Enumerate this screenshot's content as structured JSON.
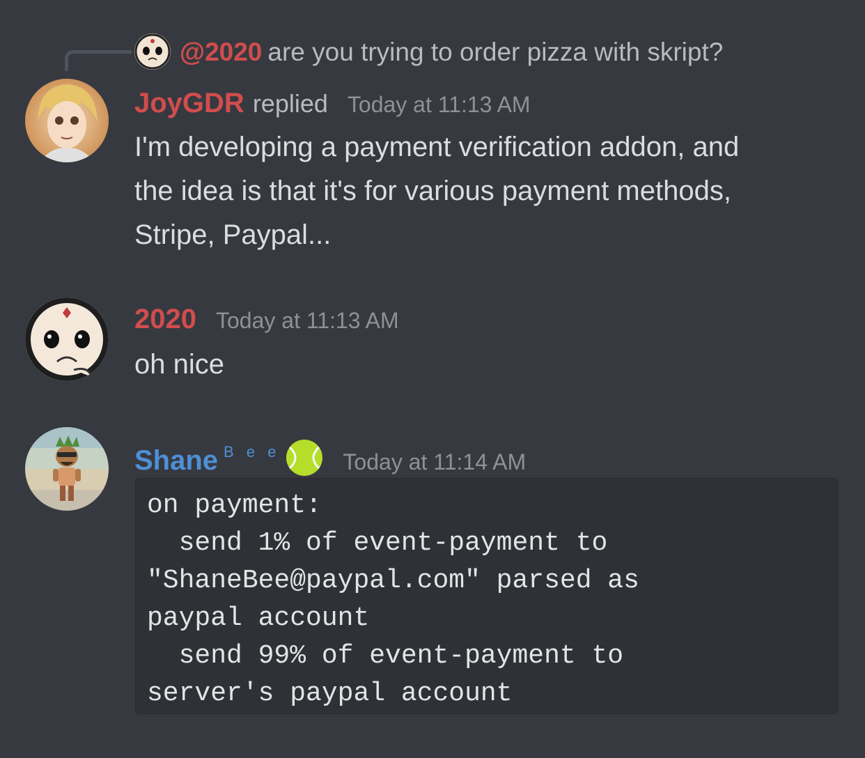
{
  "reply_reference": {
    "mention": "@2020",
    "text": "are you trying to order pizza with skript?"
  },
  "messages": [
    {
      "username": "JoyGDR",
      "username_color": "#d14d4d",
      "action": "replied",
      "timestamp": "Today at 11:13 AM",
      "lines": [
        "I'm developing a payment verification addon, and",
        "the idea is that it's for various payment methods,",
        "Stripe, Paypal..."
      ]
    },
    {
      "username": "2020",
      "username_color": "#d14d4d",
      "timestamp": "Today at 11:13 AM",
      "lines": [
        "oh nice"
      ]
    },
    {
      "username": "Shane",
      "username_color": "#4f8fd6",
      "name_suffix": "B e e",
      "badge_icon": "tennis-ball-icon",
      "timestamp": "Today at 11:14 AM",
      "code_lines": [
        "on payment:",
        "  send 1% of event-payment to",
        "\"ShaneBee@paypal.com\" parsed as",
        "paypal account",
        "  send 99% of event-payment to",
        "server's paypal account"
      ]
    }
  ],
  "colors": {
    "background": "#36393f",
    "code_background": "#2f3136",
    "text": "#dcddde",
    "muted": "#8e9297"
  }
}
